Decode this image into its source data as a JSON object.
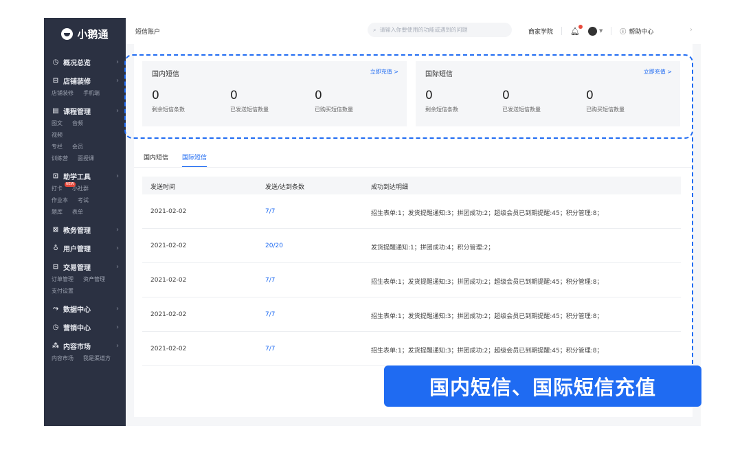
{
  "app": {
    "logo_text": "小鹅通"
  },
  "sidebar": {
    "sections": [
      {
        "icon": "◷",
        "label": "概况总览",
        "subs": []
      },
      {
        "icon": "⊟",
        "label": "店铺装修",
        "subs": [
          [
            "店铺装修",
            "手机端"
          ]
        ]
      },
      {
        "icon": "▤",
        "label": "课程管理",
        "subs": [
          [
            "图文",
            "音频"
          ],
          [
            "视频"
          ],
          [
            "专栏",
            "会员"
          ],
          [
            "训练营",
            "面授课"
          ]
        ]
      },
      {
        "icon": "⊡",
        "label": "助学工具",
        "subs": [
          [
            "打卡",
            "小社群"
          ],
          [
            "作业本",
            "考试"
          ],
          [
            "题库",
            "表单"
          ]
        ]
      },
      {
        "icon": "⊠",
        "label": "教务管理",
        "subs": []
      },
      {
        "icon": "♁",
        "label": "用户管理",
        "subs": []
      },
      {
        "icon": "⊟",
        "label": "交易管理",
        "subs": [
          [
            "订单管理",
            "资产管理"
          ],
          [
            "支付设置"
          ]
        ]
      },
      {
        "icon": "⤳",
        "label": "数据中心",
        "subs": []
      },
      {
        "icon": "◷",
        "label": "营销中心",
        "subs": []
      },
      {
        "icon": "⁂",
        "label": "内容市场",
        "subs": [
          [
            "内容市场",
            "我是渠道方"
          ]
        ]
      }
    ],
    "new_badge": "NEW"
  },
  "topbar": {
    "title": "短信账户",
    "search_placeholder": "请输入你要使用的功能或遇到的问题",
    "merchant_school": "商家学院",
    "help": "帮助中心"
  },
  "cards": [
    {
      "title": "国内短信",
      "link": "立即充值 >",
      "stats": [
        {
          "value": "0",
          "label": "剩余短信条数"
        },
        {
          "value": "0",
          "label": "已发送短信数量"
        },
        {
          "value": "0",
          "label": "已购买短信数量"
        }
      ]
    },
    {
      "title": "国际短信",
      "link": "立即充值 >",
      "stats": [
        {
          "value": "0",
          "label": "剩余短信条数"
        },
        {
          "value": "0",
          "label": "已发送短信数量"
        },
        {
          "value": "0",
          "label": "已购买短信数量"
        }
      ]
    }
  ],
  "tabs": [
    {
      "label": "国内短信",
      "active": false
    },
    {
      "label": "国际短信",
      "active": true
    }
  ],
  "table": {
    "headers": [
      "发送时间",
      "发送/达到条数",
      "成功到达明细"
    ],
    "rows": [
      [
        "2021-02-02",
        "7/7",
        "招生表单:1；发货提醒通知:3；拼团成功:2；超级会员已到期提醒:45；积分管理:8；"
      ],
      [
        "2021-02-02",
        "20/20",
        "发货提醒通知:1；拼团成功:4；积分管理:2；"
      ],
      [
        "2021-02-02",
        "7/7",
        "招生表单:1；发货提醒通知:3；拼团成功:2；超级会员已到期提醒:45；积分管理:8；"
      ],
      [
        "2021-02-02",
        "7/7",
        "招生表单:1；发货提醒通知:3；拼团成功:2；超级会员已到期提醒:45；积分管理:8；"
      ],
      [
        "2021-02-02",
        "7/7",
        "招生表单:1；发货提醒通知:3；拼团成功:2；超级会员已到期提醒:45；积分管理:8；"
      ]
    ]
  },
  "banner": {
    "text": "国内短信、国际短信充值"
  },
  "colors": {
    "accent": "#1f6bf2",
    "sidebar": "#2b3142"
  }
}
